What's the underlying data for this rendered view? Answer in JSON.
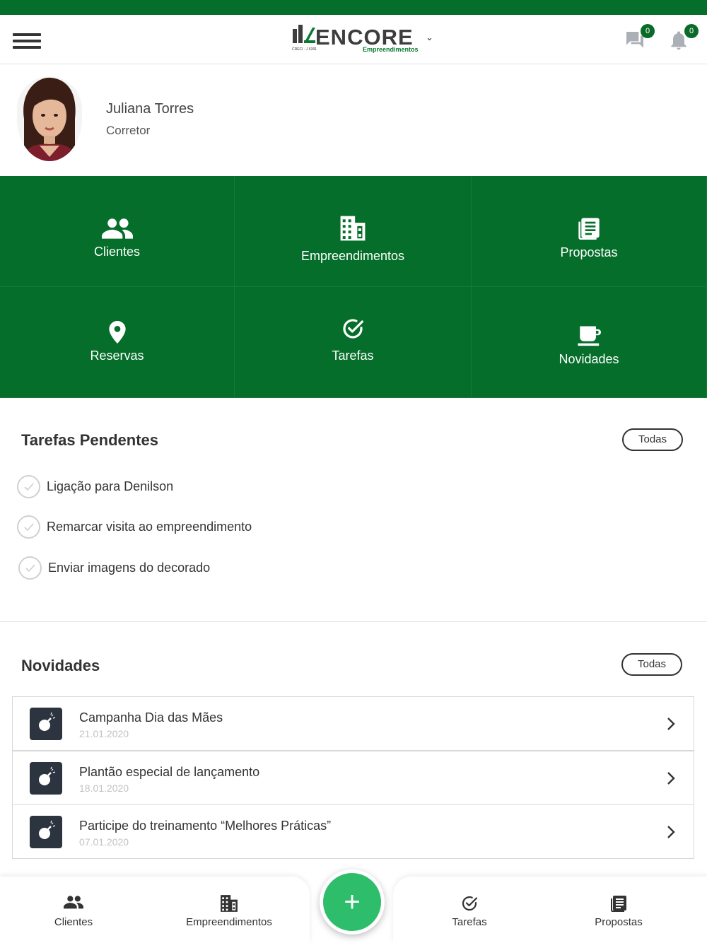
{
  "header": {
    "brand": "ENCORE",
    "brand_sub": "Empreendimentos",
    "brand_creci": "CRECI - J 6391",
    "chat_count": "0",
    "notif_count": "0"
  },
  "profile": {
    "name": "Juliana Torres",
    "role": "Corretor"
  },
  "grid": [
    {
      "label": "Clientes",
      "icon": "people-icon"
    },
    {
      "label": "Empreendimentos",
      "icon": "building-icon"
    },
    {
      "label": "Propostas",
      "icon": "document-icon"
    },
    {
      "label": "Reservas",
      "icon": "location-pin-icon"
    },
    {
      "label": "Tarefas",
      "icon": "check-circle-icon"
    },
    {
      "label": "Novidades",
      "icon": "coffee-icon"
    }
  ],
  "tasks": {
    "title": "Tarefas Pendentes",
    "all_label": "Todas",
    "items": [
      "Ligação para Denilson",
      "Remarcar visita ao empreendimento",
      "Enviar imagens do decorado"
    ]
  },
  "news": {
    "title": "Novidades",
    "all_label": "Todas",
    "items": [
      {
        "title": "Campanha Dia das Mães",
        "date": "21.01.2020"
      },
      {
        "title": "Plantão especial de lançamento",
        "date": "18.01.2020"
      },
      {
        "title": "Participe do treinamento “Melhores Práticas”",
        "date": "07.01.2020"
      }
    ]
  },
  "bottom_nav": [
    {
      "label": "Clientes"
    },
    {
      "label": "Empreendimentos"
    },
    {
      "label": "Tarefas"
    },
    {
      "label": "Propostas"
    }
  ],
  "colors": {
    "brand_green": "#056e2a",
    "fab_green": "#2dbd6b",
    "badge_green": "#0a6b29"
  }
}
